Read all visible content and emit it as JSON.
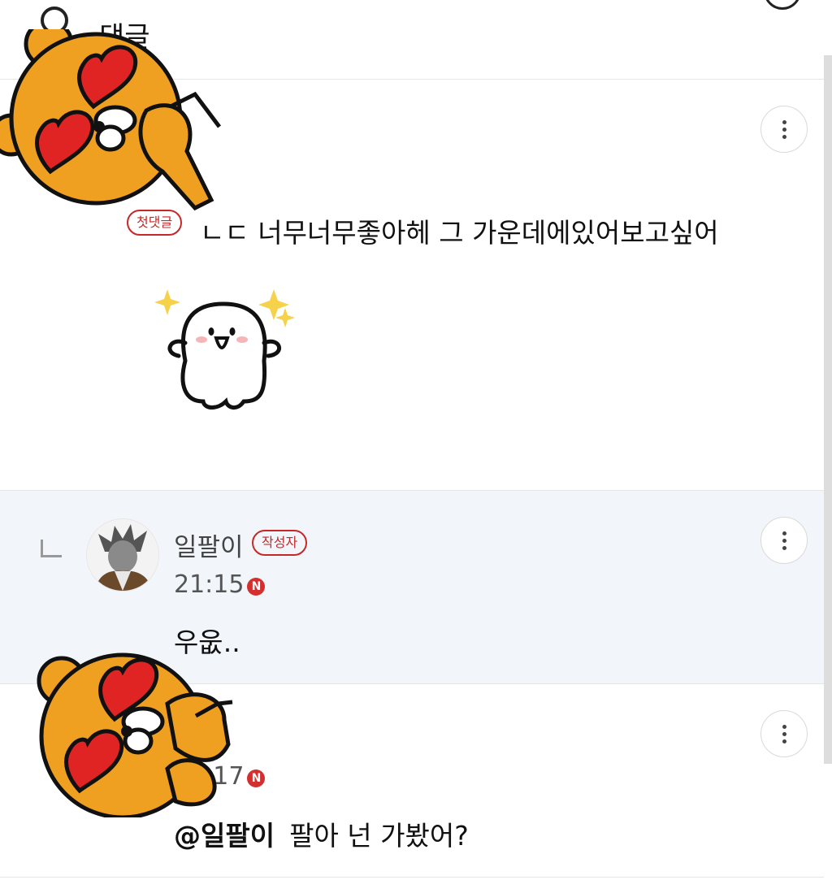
{
  "header": {
    "title": "댓글"
  },
  "comments": [
    {
      "badge": "첫댓글",
      "text": "ㄴㄷ 너무너무좋아헤 그 가운데에있어보고싶어"
    },
    {
      "nickname": "일팔이",
      "badge": "작성자",
      "time": "21:15",
      "new_badge": "N",
      "text": "우웂.."
    },
    {
      "time": "21:17",
      "new_badge": "N",
      "mention": "@일팔이",
      "text": "팔아 넌 가봤어?"
    }
  ],
  "colors": {
    "accent_red": "#c62828",
    "reply_bg": "#f2f6fa",
    "sticker_orange": "#f0a020"
  },
  "icons": [
    "circle-icon",
    "more-icon",
    "reply-arrow-icon",
    "new-badge-icon",
    "bear-sticker-icon",
    "smile-sticker-icon"
  ]
}
